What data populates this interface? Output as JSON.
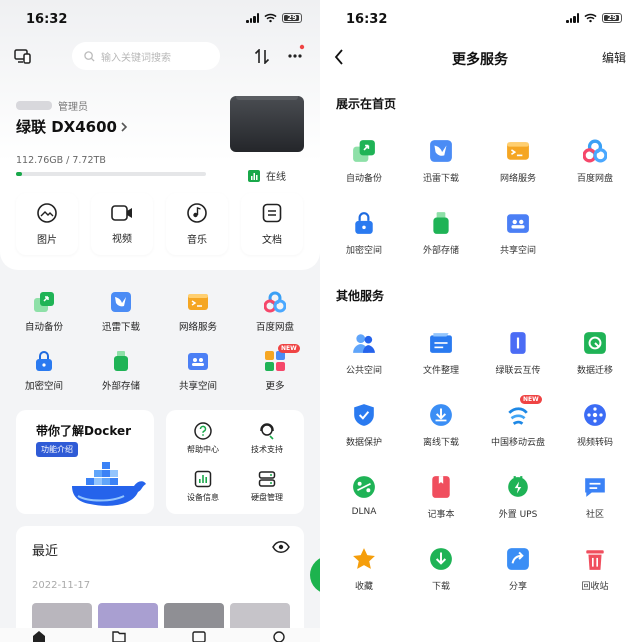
{
  "status": {
    "time": "16:32",
    "battery": "29"
  },
  "left": {
    "search_placeholder": "输入关键词搜索",
    "admin_label": "管理员",
    "device_name": "绿联 DX4600",
    "capacity": "112.76GB / 7.72TB",
    "capacity_used_fraction": 0.015,
    "status": "在线",
    "quick": [
      "图片",
      "视频",
      "音乐",
      "文档"
    ],
    "services": [
      "自动备份",
      "迅雷下载",
      "网络服务",
      "百度网盘",
      "加密空间",
      "外部存储",
      "共享空间",
      "更多"
    ],
    "more_badge": "NEW",
    "docker": {
      "title": "带你了解Docker",
      "tag": "功能介绍"
    },
    "tools": [
      "帮助中心",
      "技术支持",
      "设备信息",
      "硬盘管理"
    ],
    "recent_title": "最近",
    "recent_date": "2022-11-17"
  },
  "right": {
    "title": "更多服务",
    "edit": "编辑",
    "home_section": "展示在首页",
    "home_services": [
      "自动备份",
      "迅雷下载",
      "网络服务",
      "百度网盘",
      "加密空间",
      "外部存储",
      "共享空间"
    ],
    "other_section": "其他服务",
    "other_services": [
      "公共空间",
      "文件整理",
      "绿联云互传",
      "数据迁移",
      "数据保护",
      "离线下载",
      "中国移动云盘",
      "视频转码",
      "DLNA",
      "记事本",
      "外置 UPS",
      "社区",
      "收藏",
      "下载",
      "分享",
      "回收站"
    ],
    "new_badge": "NEW"
  },
  "colors": {
    "accent_green": "#19a84a",
    "blue": "#3b82f6",
    "orange": "#f59e0b",
    "purple": "#6d5ce7",
    "red": "#ef4444"
  }
}
